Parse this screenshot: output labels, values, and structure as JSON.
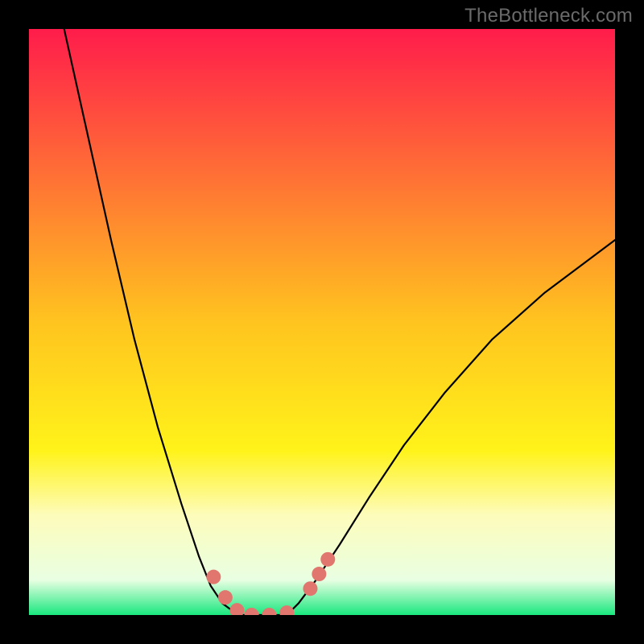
{
  "watermark": "TheBottleneck.com",
  "chart_data": {
    "type": "line",
    "title": "",
    "xlabel": "",
    "ylabel": "",
    "xlim": [
      0,
      100
    ],
    "ylim": [
      0,
      100
    ],
    "grid": false,
    "background_gradient": {
      "stops": [
        {
          "pos": 0.0,
          "color": "#ff1c4b"
        },
        {
          "pos": 0.5,
          "color": "#ffc41f"
        },
        {
          "pos": 0.72,
          "color": "#fff31a"
        },
        {
          "pos": 0.83,
          "color": "#fdfcbb"
        },
        {
          "pos": 0.94,
          "color": "#e9ffe2"
        },
        {
          "pos": 1.0,
          "color": "#19e87e"
        }
      ]
    },
    "series": [
      {
        "name": "left-curve",
        "stroke": "#000000",
        "x": [
          6,
          10,
          14,
          18,
          22,
          26,
          29,
          31,
          33,
          35,
          36.5
        ],
        "y": [
          100,
          82,
          64,
          47,
          32,
          19,
          10,
          5,
          2,
          0.5,
          0
        ]
      },
      {
        "name": "valley-floor",
        "stroke": "#000000",
        "x": [
          36.5,
          44
        ],
        "y": [
          0,
          0
        ]
      },
      {
        "name": "right-curve",
        "stroke": "#000000",
        "x": [
          44,
          46,
          49,
          53,
          58,
          64,
          71,
          79,
          88,
          100
        ],
        "y": [
          0,
          2,
          6,
          12,
          20,
          29,
          38,
          47,
          55,
          64
        ]
      }
    ],
    "markers": {
      "name": "highlight-dots",
      "color": "#e0766e",
      "radius_px": 9,
      "points": [
        {
          "x": 31.5,
          "y": 6.5
        },
        {
          "x": 33.5,
          "y": 3.0
        },
        {
          "x": 35.5,
          "y": 0.8
        },
        {
          "x": 38.0,
          "y": 0.0
        },
        {
          "x": 41.0,
          "y": 0.0
        },
        {
          "x": 44.0,
          "y": 0.4
        },
        {
          "x": 48.0,
          "y": 4.5
        },
        {
          "x": 49.5,
          "y": 7.0
        },
        {
          "x": 51.0,
          "y": 9.5
        }
      ]
    }
  }
}
